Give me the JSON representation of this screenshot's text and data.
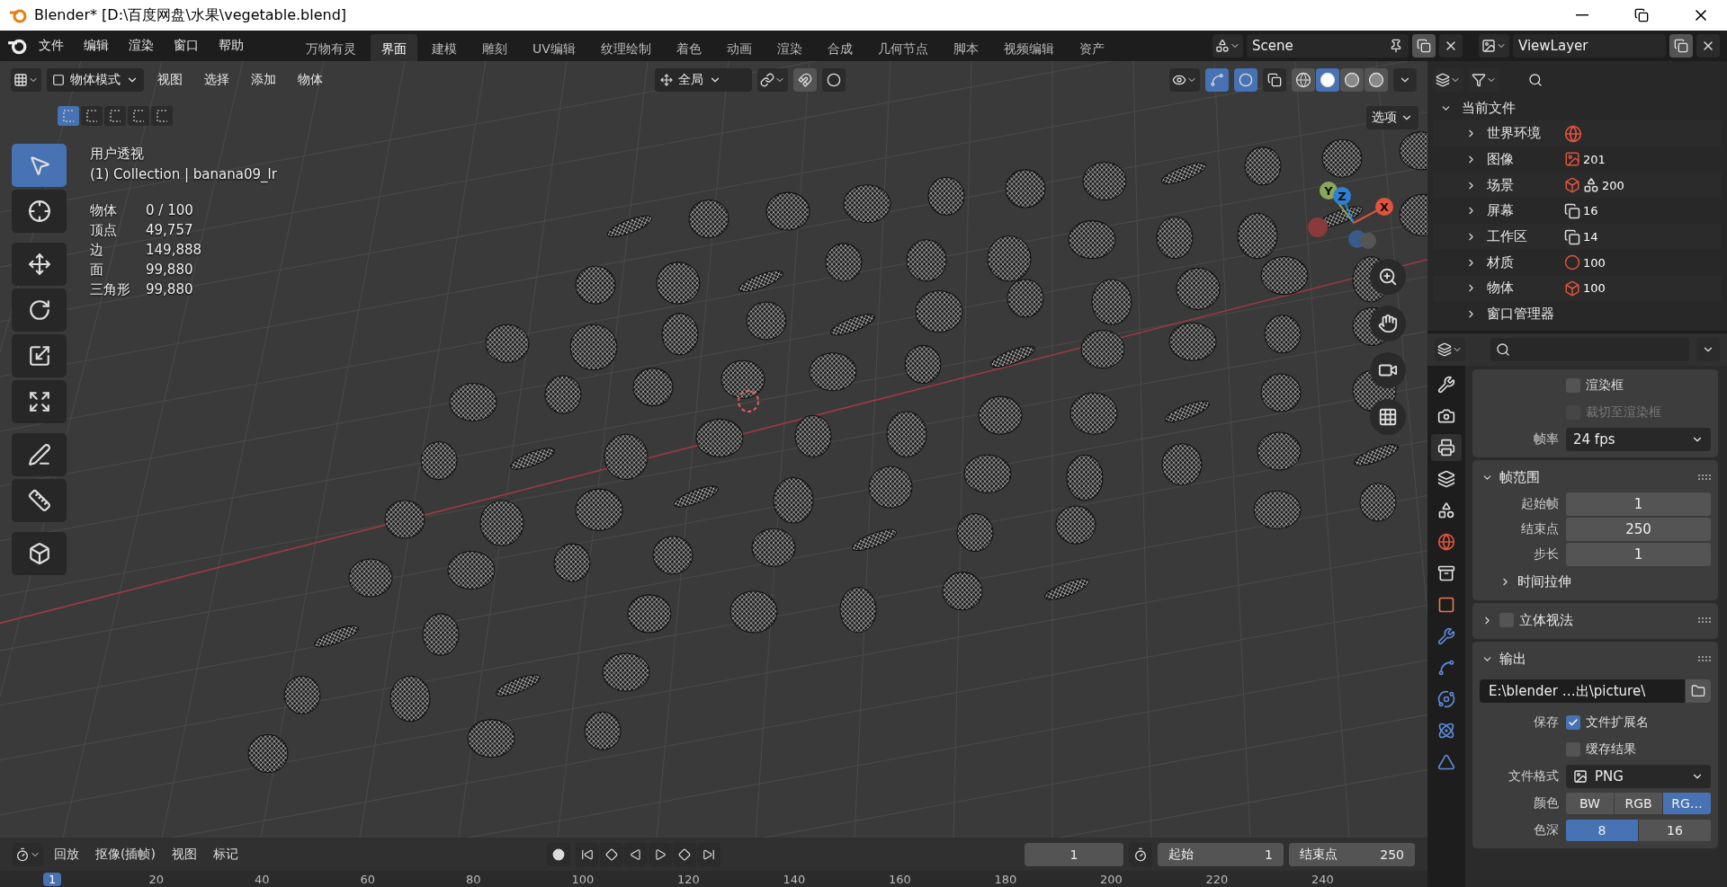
{
  "window": {
    "title": "Blender* [D:\\百度网盘\\水果\\vegetable.blend]"
  },
  "menu": [
    "文件",
    "编辑",
    "渲染",
    "窗口",
    "帮助"
  ],
  "workspaces": [
    {
      "label": "万物有灵",
      "selected": false
    },
    {
      "label": "界面",
      "selected": true
    },
    {
      "label": "建模",
      "selected": false
    },
    {
      "label": "雕刻",
      "selected": false
    },
    {
      "label": "UV编辑",
      "selected": false
    },
    {
      "label": "纹理绘制",
      "selected": false
    },
    {
      "label": "着色",
      "selected": false
    },
    {
      "label": "动画",
      "selected": false
    },
    {
      "label": "渲染",
      "selected": false
    },
    {
      "label": "合成",
      "selected": false
    },
    {
      "label": "几何节点",
      "selected": false
    },
    {
      "label": "脚本",
      "selected": false
    },
    {
      "label": "视频编辑",
      "selected": false
    },
    {
      "label": "资产",
      "selected": false
    }
  ],
  "scene": {
    "name": "Scene"
  },
  "view_layer": {
    "name": "ViewLayer"
  },
  "viewport_header": {
    "mode": "物体模式",
    "menus": [
      "视图",
      "选择",
      "添加",
      "物体"
    ],
    "orientation": "全局",
    "options": "选项"
  },
  "select_modes": [
    {
      "selected": true
    },
    {
      "selected": false
    },
    {
      "selected": false
    },
    {
      "selected": false
    },
    {
      "selected": false
    }
  ],
  "shading_modes": [
    {
      "kind": "wireframe",
      "selected": false
    },
    {
      "kind": "solid",
      "selected": true
    },
    {
      "kind": "material",
      "selected": false
    },
    {
      "kind": "rendered",
      "selected": false
    }
  ],
  "tools": [
    {
      "kind": "select",
      "selected": true
    },
    {
      "kind": "cursor",
      "selected": false
    },
    {
      "kind": "move",
      "selected": false
    },
    {
      "kind": "rotate",
      "selected": false
    },
    {
      "kind": "scale",
      "selected": false
    },
    {
      "kind": "transform",
      "selected": false
    },
    {
      "kind": "annotate",
      "selected": false
    },
    {
      "kind": "measure",
      "selected": false
    },
    {
      "kind": "add-cube",
      "selected": false
    }
  ],
  "overlay": {
    "view_name": "用户透视",
    "collection": "(1) Collection | banana09_lr",
    "stats": [
      {
        "label": "物体",
        "value": "0 / 100"
      },
      {
        "label": "顶点",
        "value": "49,757"
      },
      {
        "label": "边",
        "value": "149,888"
      },
      {
        "label": "面",
        "value": "99,880"
      },
      {
        "label": "三角形",
        "value": "99,880"
      }
    ]
  },
  "gizmo": {
    "axes": [
      {
        "label": "Y",
        "color": "#8aa85a"
      },
      {
        "label": "Z",
        "color": "#2f7fd4"
      },
      {
        "label": "X",
        "color": "#e0533f"
      }
    ]
  },
  "outliner": {
    "label": "当前文件",
    "expanded": true,
    "children": [
      {
        "label": "世界环境",
        "expanded": false,
        "kind": "world"
      },
      {
        "label": "图像",
        "expanded": false,
        "kind": "image",
        "count": "201"
      },
      {
        "label": "场景",
        "expanded": false,
        "kind": "scene",
        "count": "200"
      },
      {
        "label": "屏幕",
        "expanded": false,
        "kind": "screen",
        "count": "16"
      },
      {
        "label": "工作区",
        "expanded": false,
        "kind": "screen",
        "count": "14"
      },
      {
        "label": "材质",
        "expanded": false,
        "kind": "material",
        "count": "100"
      },
      {
        "label": "物体",
        "expanded": false,
        "kind": "object",
        "count": "100"
      },
      {
        "label": "窗口管理器",
        "expanded": false,
        "kind": "none"
      }
    ]
  },
  "properties": {
    "tabs": [
      {
        "kind": "tool",
        "selected": false
      },
      {
        "kind": "render",
        "selected": false
      },
      {
        "kind": "output",
        "selected": true
      },
      {
        "kind": "view-layer",
        "selected": false
      },
      {
        "kind": "scene",
        "selected": false
      },
      {
        "kind": "world",
        "selected": false
      },
      {
        "kind": "collection",
        "selected": false
      },
      {
        "kind": "object",
        "selected": false
      },
      {
        "kind": "modifier",
        "selected": false
      },
      {
        "kind": "particles",
        "selected": false
      },
      {
        "kind": "physics",
        "selected": false
      },
      {
        "kind": "constraints",
        "selected": false
      },
      {
        "kind": "data",
        "selected": false
      }
    ],
    "format": {
      "border": {
        "label": "渲染框",
        "checked": false
      },
      "crop": {
        "label": "裁切至渲染框",
        "checked": false,
        "disabled": true
      },
      "frame_rate_label": "帧率",
      "frame_rate": "24 fps"
    },
    "frame_range": {
      "title": "帧范围",
      "expanded": true,
      "fields": [
        {
          "label": "起始帧",
          "value": "1"
        },
        {
          "label": "结束点",
          "value": "250"
        },
        {
          "label": "步长",
          "value": "1"
        }
      ],
      "subpanel": {
        "title": "时间拉伸",
        "expanded": false
      }
    },
    "stereoscopy": {
      "title": "立体视法",
      "expanded": false,
      "checked": false
    },
    "output": {
      "title": "输出",
      "expanded": true,
      "path": "E:\\blender …出\\picture\\",
      "save_label": "保存",
      "file_extensions": {
        "label": "文件扩展名",
        "checked": true
      },
      "cache_result": {
        "label": "缓存结果",
        "checked": false
      },
      "format_label": "文件格式",
      "format": "PNG",
      "color_label": "颜色",
      "color_modes": [
        {
          "label": "BW",
          "selected": false
        },
        {
          "label": "RGB",
          "selected": false
        },
        {
          "label": "RG…",
          "selected": true
        }
      ],
      "depth_label": "色深",
      "depths": [
        {
          "label": "8",
          "selected": true
        },
        {
          "label": "16",
          "selected": false
        }
      ]
    }
  },
  "timeline": {
    "menus": [
      "回放",
      "抠像(插帧)",
      "视图",
      "标记"
    ],
    "current_frame": "1",
    "start_label": "起始",
    "start": "1",
    "end_label": "结束点",
    "end": "250",
    "ruler": [
      {
        "label": "1",
        "selected": true
      },
      {
        "label": "20",
        "selected": false
      },
      {
        "label": "40",
        "selected": false
      },
      {
        "label": "60",
        "selected": false
      },
      {
        "label": "80",
        "selected": false
      },
      {
        "label": "100",
        "selected": false
      },
      {
        "label": "120",
        "selected": false
      },
      {
        "label": "140",
        "selected": false
      },
      {
        "label": "160",
        "selected": false
      },
      {
        "label": "180",
        "selected": false
      },
      {
        "label": "200",
        "selected": false
      },
      {
        "label": "220",
        "selected": false
      },
      {
        "label": "240",
        "selected": false
      }
    ]
  }
}
